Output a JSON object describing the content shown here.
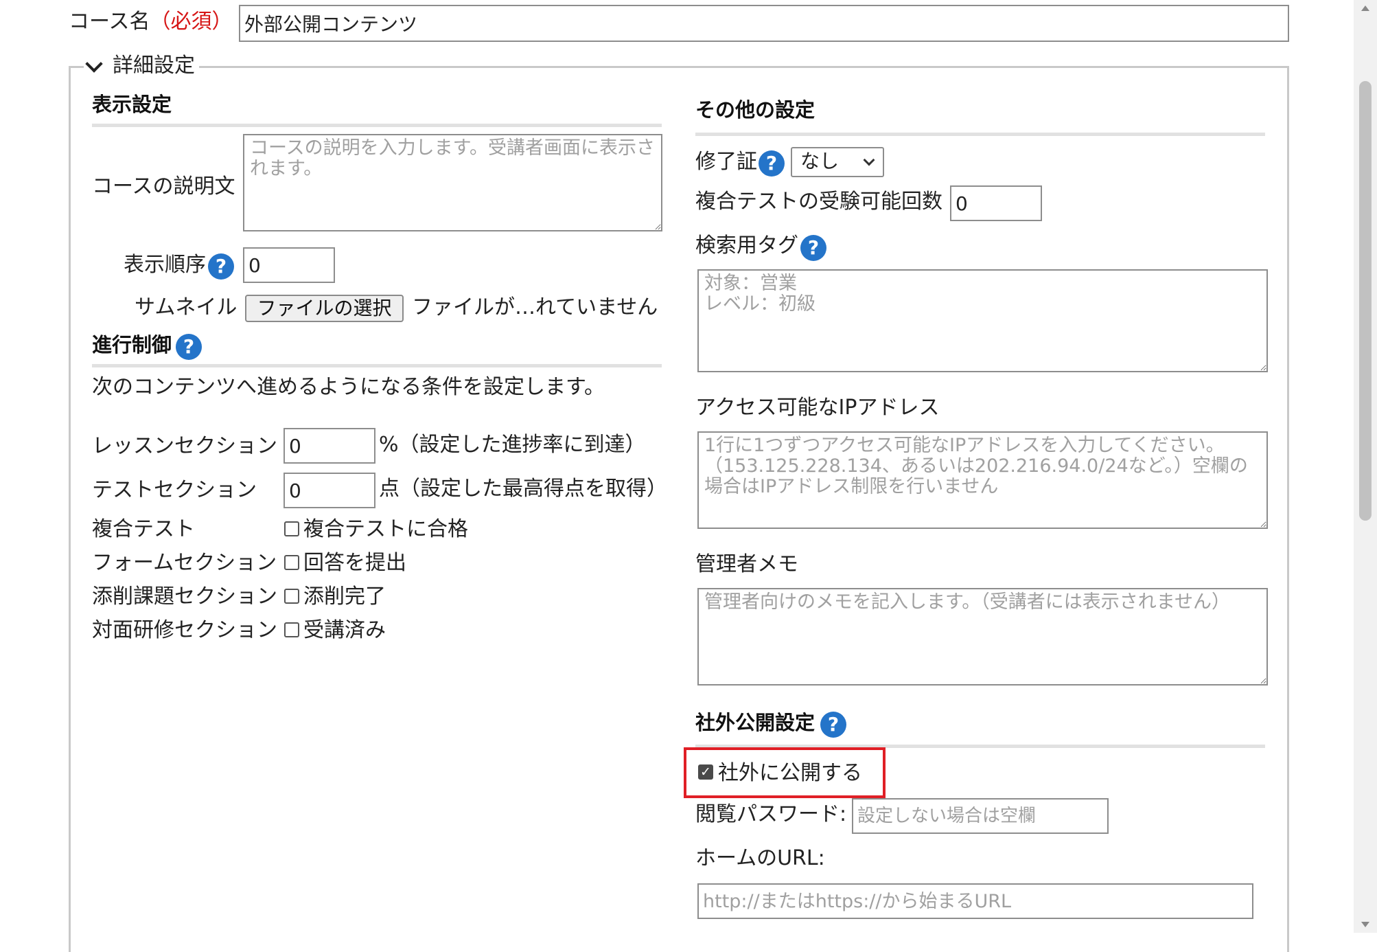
{
  "course": {
    "label": "コース名",
    "required": "（必須）",
    "value": "外部公開コンテンツ"
  },
  "details": {
    "legend": "詳細設定",
    "toggle_icon": "chevron-down-icon"
  },
  "display": {
    "heading": "表示設定",
    "description_label": "コースの説明文",
    "description_placeholder": "コースの説明を入力します。受講者画面に表示されます。",
    "order_label": "表示順序",
    "order_value": "0",
    "thumbnail_label": "サムネイル",
    "file_button": "ファイルの選択",
    "file_status": "ファイルが…れていません"
  },
  "progress": {
    "heading": "進行制御",
    "intro": "次のコンテンツへ進めるようになる条件を設定します。",
    "lesson_label": "レッスンセクション",
    "lesson_value": "0",
    "lesson_suffix": "%（設定した進捗率に到達）",
    "test_label": "テストセクション",
    "test_value": "0",
    "test_suffix": "点（設定した最高得点を取得）",
    "composite_label": "複合テスト",
    "composite_check": "複合テストに合格",
    "form_label": "フォームセクション",
    "form_check": "回答を提出",
    "assign_label": "添削課題セクション",
    "assign_check": "添削完了",
    "f2f_label": "対面研修セクション",
    "f2f_check": "受講済み"
  },
  "other": {
    "heading": "その他の設定",
    "cert_label": "修了証",
    "cert_value": "なし",
    "attempts_label": "複合テストの受験可能回数",
    "attempts_value": "0",
    "tags_label": "検索用タグ",
    "tags_placeholder": "対象：営業\nレベル：初級",
    "ip_label": "アクセス可能なIPアドレス",
    "ip_placeholder": "1行に1つずつアクセス可能なIPアドレスを入力してください。（153.125.228.134、あるいは202.216.94.0/24など。）空欄の場合はIPアドレス制限を行いません",
    "memo_label": "管理者メモ",
    "memo_placeholder": "管理者向けのメモを記入します。（受講者には表示されません）"
  },
  "external": {
    "heading": "社外公開設定",
    "publish_label": "社外に公開する",
    "publish_checked": true,
    "password_label": "閲覧パスワード:",
    "password_placeholder": "設定しない場合は空欄",
    "home_label": "ホームのURL:",
    "home_placeholder": "http://またはhttps://から始まるURL"
  },
  "help_glyph": "?",
  "check_glyph": "✓"
}
